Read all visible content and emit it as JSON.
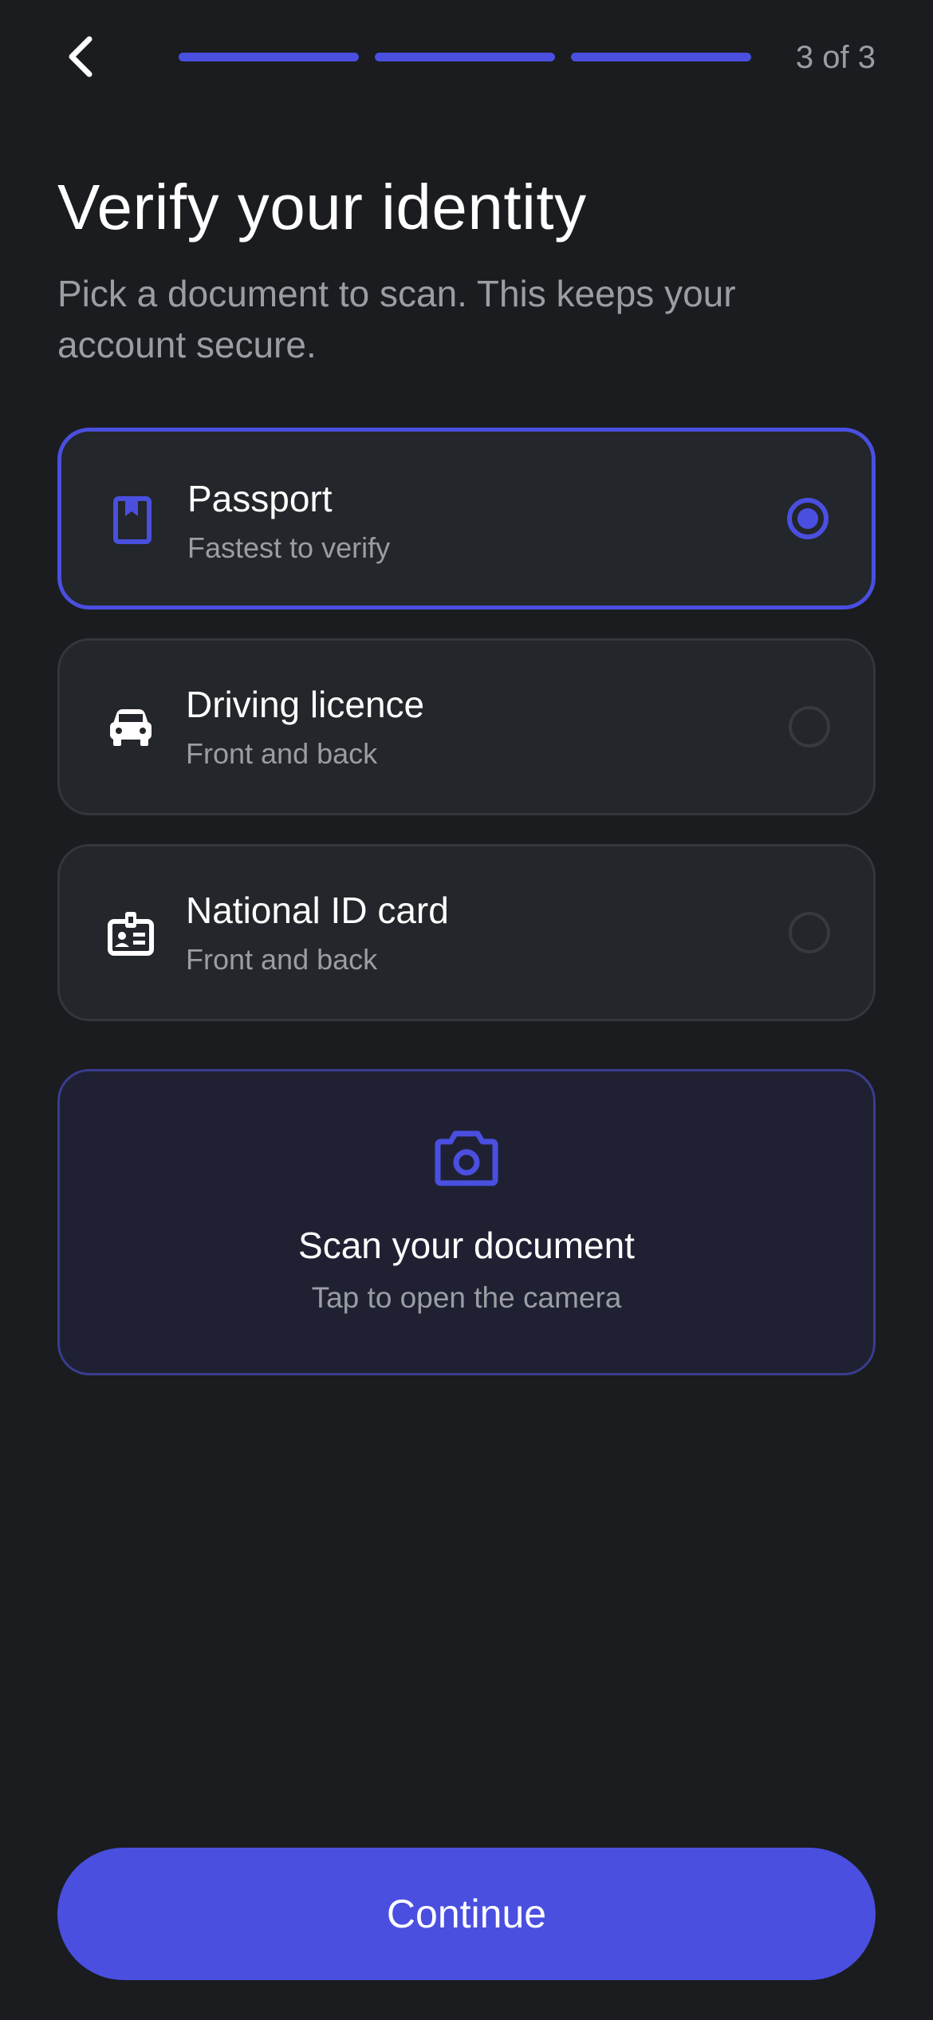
{
  "header": {
    "back_icon": "chevron-left-icon",
    "progress": {
      "current": 3,
      "total": 3
    },
    "step_label": "3 of 3",
    "accent_color": "#4A4FE0"
  },
  "title": "Verify your identity",
  "subtitle": "Pick a document to scan. This keeps your account secure.",
  "options": [
    {
      "label": "Passport",
      "sublabel": "Fastest to verify",
      "icon": "passport-icon",
      "selected": true
    },
    {
      "label": "Driving licence",
      "sublabel": "Front and back",
      "icon": "car-icon",
      "selected": false
    },
    {
      "label": "National ID card",
      "sublabel": "Front and back",
      "icon": "id-card-icon",
      "selected": false
    }
  ],
  "scan": {
    "icon": "camera-icon",
    "title": "Scan your document",
    "subtitle": "Tap to open the camera"
  },
  "continue_label": "Continue",
  "colors": {
    "background": "#1A1C1F",
    "card": "#23262A",
    "accent": "#4A4FE0",
    "muted_text": "#9A9DA3"
  }
}
